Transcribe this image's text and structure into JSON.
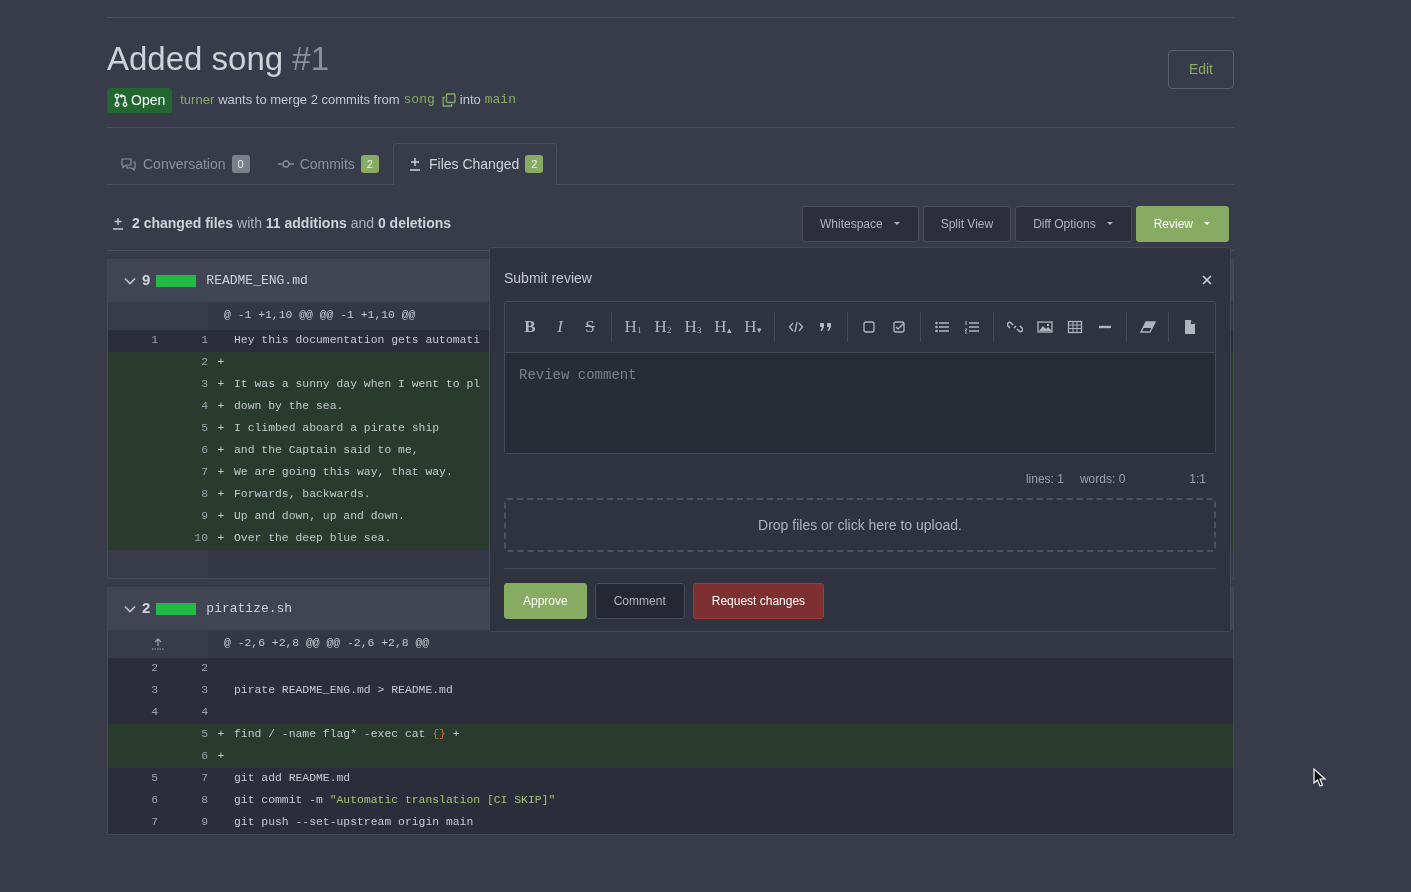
{
  "pull_request": {
    "title": "Added song",
    "number": "#1",
    "edit_button": "Edit",
    "status": {
      "label": "Open"
    },
    "author": "turner",
    "merge_text": "wants to merge 2 commits from",
    "head_branch": "song",
    "into_text": "into",
    "base_branch": "main"
  },
  "tabs": [
    {
      "label": "Conversation",
      "count": "0",
      "color": "#7a7f8c",
      "selected": false
    },
    {
      "label": "Commits",
      "count": "2",
      "color": "#87ab63",
      "selected": false
    },
    {
      "label": "Files Changed",
      "count": "2",
      "color": "#87ab63",
      "selected": true
    }
  ],
  "diff_summary": "**2 changed files** with **11 additions** and **0 deletions**",
  "toolbar_buttons": [
    {
      "label": "Whitespace",
      "dropdown": true,
      "kind": "default"
    },
    {
      "label": "Split View",
      "dropdown": false,
      "kind": "default"
    },
    {
      "label": "Diff Options",
      "dropdown": true,
      "kind": "default"
    },
    {
      "label": "Review",
      "dropdown": true,
      "kind": "primary"
    }
  ],
  "files": [
    {
      "additions": "9",
      "name": "README_ENG.md",
      "expanded": true,
      "hunk": "@ -1 +1,10 @@ @@ -1 +1,10 @@",
      "expand_icon": false,
      "trailing_row": true,
      "lines": [
        {
          "old": "1",
          "new": "1",
          "kind": "context",
          "tokens": [
            {
              "text": "Hey this documentation gets automati",
              "kind": "plain"
            }
          ]
        },
        {
          "new": "2",
          "kind": "added",
          "sign": "+"
        },
        {
          "new": "3",
          "kind": "added",
          "sign": "+",
          "tokens": [
            {
              "text": "It was a sunny day when I went to pl",
              "kind": "plain"
            }
          ]
        },
        {
          "new": "4",
          "kind": "added",
          "sign": "+",
          "tokens": [
            {
              "text": "down by the sea.",
              "kind": "plain"
            }
          ]
        },
        {
          "new": "5",
          "kind": "added",
          "sign": "+",
          "tokens": [
            {
              "text": "I climbed aboard a pirate ship",
              "kind": "plain"
            }
          ]
        },
        {
          "new": "6",
          "kind": "added",
          "sign": "+",
          "tokens": [
            {
              "text": "and the Captain said to me,",
              "kind": "plain"
            }
          ]
        },
        {
          "new": "7",
          "kind": "added",
          "sign": "+",
          "tokens": [
            {
              "text": "We are going this way, that way.",
              "kind": "plain"
            }
          ]
        },
        {
          "new": "8",
          "kind": "added",
          "sign": "+",
          "tokens": [
            {
              "text": "Forwards, backwards.",
              "kind": "plain"
            }
          ]
        },
        {
          "new": "9",
          "kind": "added",
          "sign": "+",
          "tokens": [
            {
              "text": "Up and down, up and down.",
              "kind": "plain"
            }
          ]
        },
        {
          "new": "10",
          "kind": "added",
          "sign": "+",
          "tokens": [
            {
              "text": "Over the deep blue sea.",
              "kind": "plain"
            }
          ]
        }
      ]
    },
    {
      "additions": "2",
      "name": "piratize.sh",
      "expanded": true,
      "hunk": "@ -2,6 +2,8 @@ @@ -2,6 +2,8 @@",
      "expand_icon": true,
      "trailing_row": false,
      "lines": [
        {
          "old": "2",
          "new": "2",
          "kind": "context"
        },
        {
          "old": "3",
          "new": "3",
          "kind": "context",
          "tokens": [
            {
              "text": "pirate README_ENG.md > README.md",
              "kind": "plain"
            }
          ]
        },
        {
          "old": "4",
          "new": "4",
          "kind": "context"
        },
        {
          "new": "5",
          "kind": "added",
          "sign": "+",
          "tokens": [
            {
              "text": "find / -name flag* -exec cat ",
              "kind": "plain"
            },
            {
              "text": "{}",
              "kind": "brace"
            },
            {
              "text": " +",
              "kind": "plain"
            }
          ]
        },
        {
          "new": "6",
          "kind": "added",
          "sign": "+"
        },
        {
          "old": "5",
          "new": "7",
          "kind": "context",
          "tokens": [
            {
              "text": "git add README.md",
              "kind": "plain"
            }
          ]
        },
        {
          "old": "6",
          "new": "8",
          "kind": "context",
          "tokens": [
            {
              "text": "git commit -m ",
              "kind": "plain"
            },
            {
              "text": "\"Automatic translation [CI SKIP]\"",
              "kind": "string"
            }
          ]
        },
        {
          "old": "7",
          "new": "9",
          "kind": "context",
          "tokens": [
            {
              "text": "git push --set-upstream origin main",
              "kind": "plain"
            }
          ]
        }
      ]
    }
  ],
  "review_popup": {
    "title": "Submit review",
    "format_groups": [
      [
        {
          "label": "B",
          "kind": "bold"
        },
        {
          "label": "I",
          "kind": "italic"
        },
        {
          "label": "S",
          "kind": "strike"
        }
      ],
      [
        {
          "label": "H$_{1}$",
          "kind": "heading"
        },
        {
          "label": "H$_{2}$",
          "kind": "heading"
        },
        {
          "label": "H$_{3}$",
          "kind": "heading"
        },
        {
          "label": "H$_{▴}$",
          "kind": "heading"
        },
        {
          "label": "H$_{▾}$",
          "kind": "heading"
        }
      ]
    ],
    "placeholder": "Review comment",
    "lines": "lines: 1",
    "words": "words: 0",
    "cursor": "1:1",
    "upload": "Drop files or click here to upload.",
    "buttons": [
      {
        "label": "Approve",
        "kind": "approve"
      },
      {
        "label": "Comment",
        "kind": "comment"
      },
      {
        "label": "Request changes",
        "kind": "reject"
      }
    ]
  }
}
